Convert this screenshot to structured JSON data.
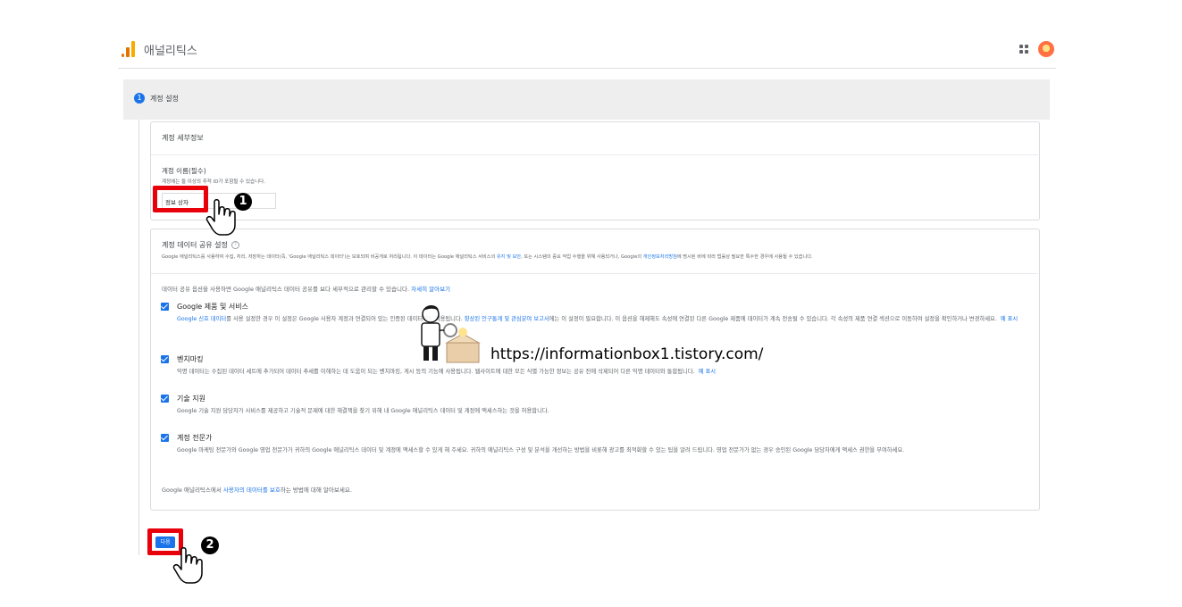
{
  "header": {
    "app_title": "애널리틱스"
  },
  "step": {
    "number": "1",
    "label": "계정 설정"
  },
  "account_details": {
    "title": "계정 세부정보",
    "name_label": "계정 이름(필수)",
    "name_hint": "계정에는 둘 이상의 추적 ID가 포함될 수 있습니다.",
    "name_value": "정보 상자"
  },
  "data_sharing": {
    "title": "계정 데이터 공유 설정",
    "help_glyph": "?",
    "desc_prefix": "Google 애널리틱스를 사용하여 수집, 처리, 저장하는 데이터(즉, 'Google 애널리틱스 데이터')는 보호되며 비공개로 처리됩니다. 이 데이터는 Google 애널리틱스 서비스의 ",
    "desc_link1": "유지 및 보안",
    "desc_middle": ", 또는 시스템의 중요 작업 수행을 위해 사용되거나, Google의 ",
    "desc_link2": "개인정보처리방침",
    "desc_suffix": "에 명시된 바에 따라 법률상 필요한 특수한 경우에 사용될 수 있습니다.",
    "intro_prefix": "데이터 공유 옵션을 사용하면 Google 애널리틱스 데이터 공유를 보다 세부적으로 관리할 수 있습니다.",
    "intro_link": "자세히 알아보기",
    "options": [
      {
        "title": "Google 제품 및 서비스",
        "desc_link1": "Google 신호 데이터",
        "desc_a": "를 사용 설정한 경우 이 설정은 Google 사용자 계정과 연결되어 있는 인증된 데이터에도 적용됩니다. ",
        "desc_link2": "향상된 인구통계 및 관심분야 보고서",
        "desc_b": "에는 이 설정이 필요합니다. 이 옵션을 해제해도 속성에 연결된 다른 Google 제품에 데이터가 계속 전송될 수 있습니다. 각 속성의 제품 연결 섹션으로 이동하여 설정을 확인하거나 변경하세요.",
        "example": "예 표시"
      },
      {
        "title": "벤치마킹",
        "desc": "익명 데이터는 수집된 데이터 세트에 추가되어 데이터 추세를 이해하는 데 도움이 되는 벤치마킹, 게시 등의 기능에 사용됩니다. 웹사이트에 대한 모든 식별 가능한 정보는 공유 전에 삭제되어 다른 익명 데이터와 통합됩니다.",
        "example": "예 표시"
      },
      {
        "title": "기술 지원",
        "desc": "Google 기술 지원 담당자가 서비스를 제공하고 기술적 문제에 대한 해결책을 찾기 위해 내 Google 애널리틱스 데이터 및 계정에 액세스하는 것을 허용합니다."
      },
      {
        "title": "계정 전문가",
        "desc": "Google 마케팅 전문가와 Google 영업 전문가가 귀하의 Google 애널리틱스 데이터 및 계정에 액세스할 수 있게 해 주세요. 귀하의 애널리틱스 구성 및 분석을 개선하는 방법을 비롯해 광고를 최적화할 수 있는 팁을 알려 드립니다. 영업 전문가가 없는 경우 승인된 Google 담당자에게 액세스 권한을 부여하세요."
      }
    ],
    "footer_prefix": "Google 애널리틱스에서 ",
    "footer_link": "사용자의 데이터를 보호",
    "footer_suffix": "하는 방법에 대해 알아보세요."
  },
  "next_button": "다음",
  "annotations": {
    "badge1": "1",
    "badge2": "2",
    "watermark": "https://informationbox1.tistory.com/"
  },
  "colors": {
    "accent": "#1a73e8",
    "highlight": "#e8000b"
  }
}
